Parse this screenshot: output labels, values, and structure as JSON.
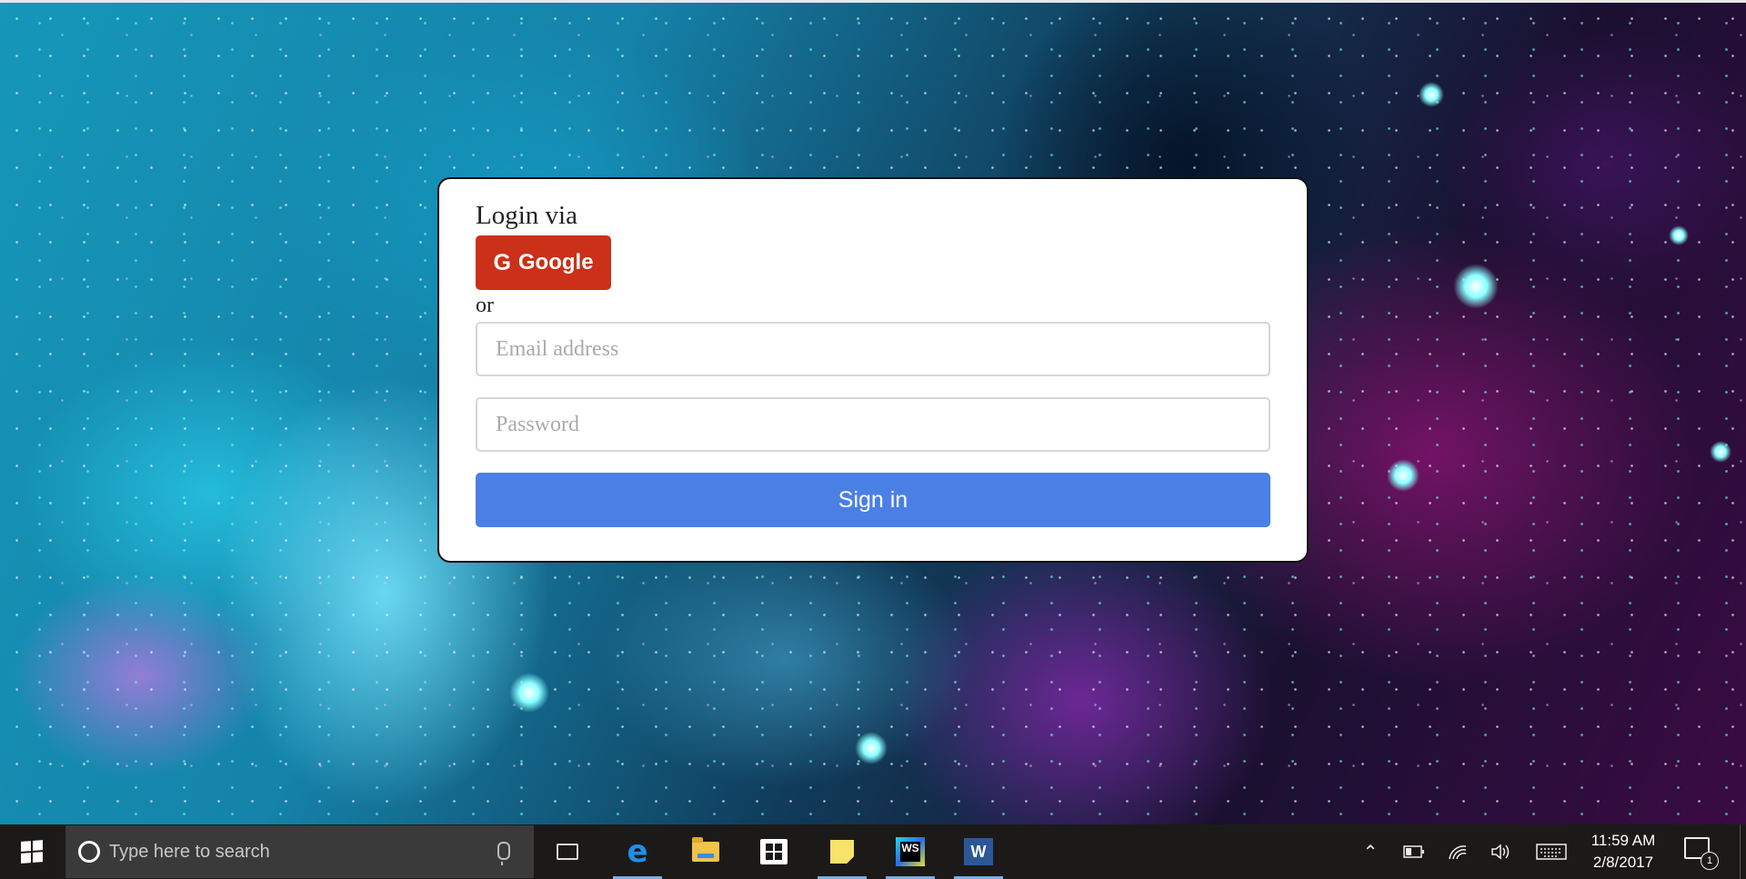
{
  "login": {
    "heading": "Login via",
    "google_label": "Google",
    "google_icon": "G",
    "or_text": "or",
    "email_placeholder": "Email address",
    "password_placeholder": "Password",
    "signin_label": "Sign in"
  },
  "taskbar": {
    "search_placeholder": "Type here to search",
    "apps": [
      "task-view",
      "edge",
      "file-explorer",
      "store",
      "sticky-notes",
      "webstorm",
      "word"
    ],
    "webstorm_badge": "WS",
    "word_badge": "W",
    "time": "11:59 AM",
    "date": "2/8/2017",
    "notification_count": "1"
  },
  "colors": {
    "google_button": "#cb3019",
    "signin_button": "#4a80e6",
    "taskbar": "#1c1a19"
  }
}
